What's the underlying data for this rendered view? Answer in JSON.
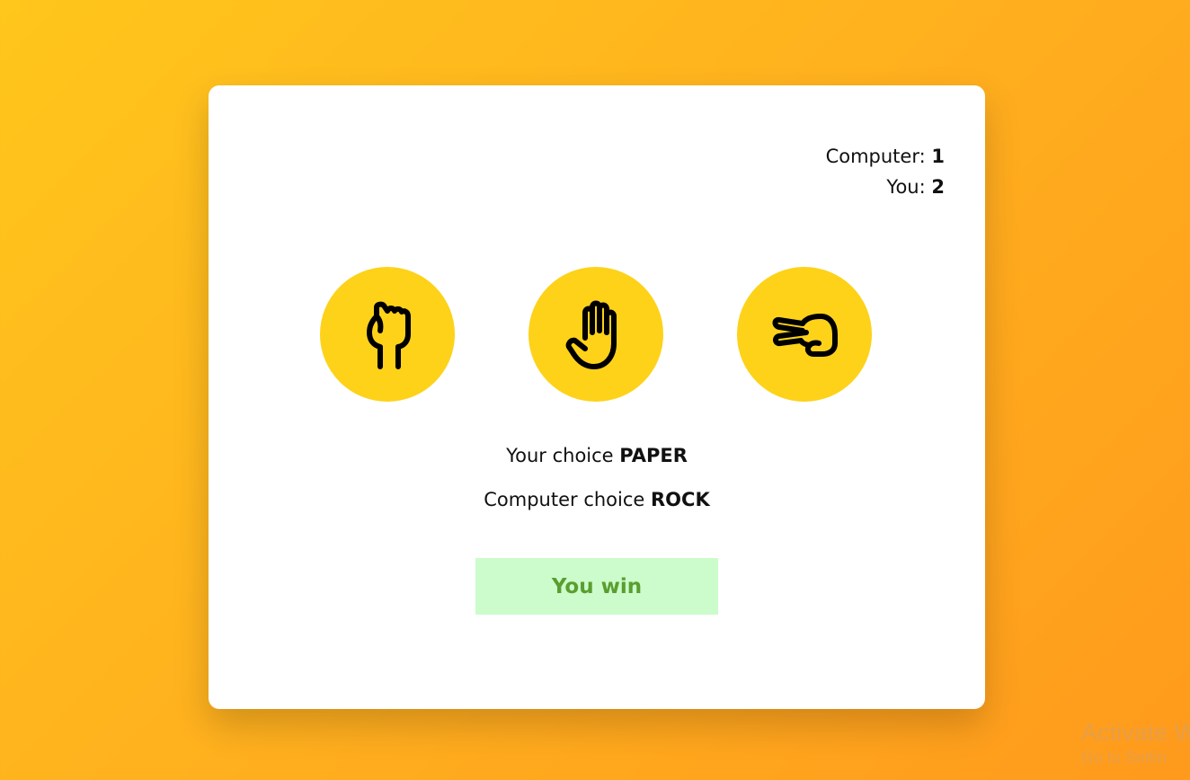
{
  "scoreboard": {
    "computer_label": "Computer:",
    "computer_score": "1",
    "you_label": "You:",
    "you_score": "2"
  },
  "choices": [
    {
      "name": "ROCK",
      "icon": "rock-fist-icon"
    },
    {
      "name": "PAPER",
      "icon": "paper-hand-icon"
    },
    {
      "name": "SCISSORS",
      "icon": "scissors-hand-icon"
    }
  ],
  "result": {
    "your_choice_label": "Your choice",
    "your_choice_value": "PAPER",
    "computer_choice_label": "Computer choice",
    "computer_choice_value": "ROCK",
    "outcome": "You win"
  },
  "colors": {
    "background_start": "#ffc61c",
    "background_end": "#ff9a1c",
    "choice_circle": "#fdd219",
    "outcome_bg": "#ccfccb",
    "outcome_text": "#5a9e2f"
  },
  "watermark": {
    "line1": "Activate W",
    "line2": "Go to Settin"
  }
}
